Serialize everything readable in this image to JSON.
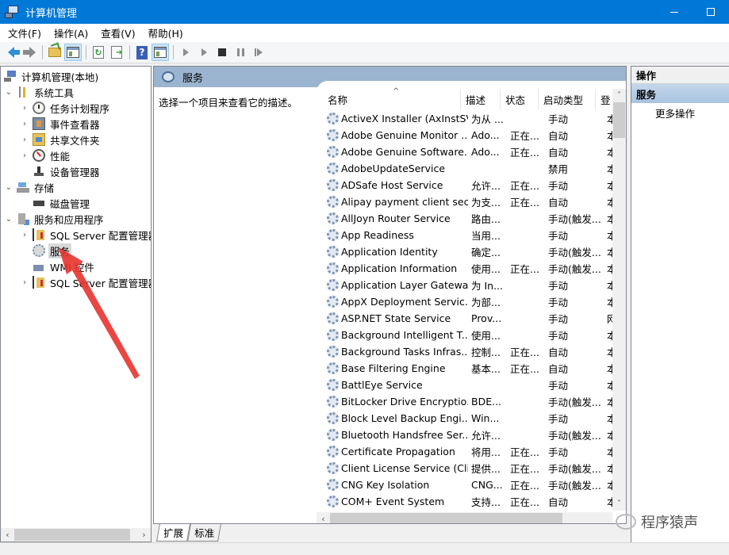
{
  "window": {
    "title": "计算机管理",
    "minimize_label": "—",
    "maximize_label": "□"
  },
  "menu": [
    "文件(F)",
    "操作(A)",
    "查看(V)",
    "帮助(H)"
  ],
  "toolbar": {
    "buttons": [
      "back-icon",
      "forward-icon",
      "up-folder-icon",
      "show-hide-tree-icon",
      "refresh-icon",
      "export-list-icon",
      "help-icon",
      "show-hide-action-pane-icon",
      "start-service-icon",
      "start-service-alt-icon",
      "stop-service-icon",
      "pause-service-icon",
      "resume-service-icon"
    ]
  },
  "tree": {
    "root": "计算机管理(本地)",
    "nodes": [
      {
        "label": "系统工具",
        "expander": "⌄"
      },
      {
        "label": "任务计划程序",
        "expander": "›"
      },
      {
        "label": "事件查看器",
        "expander": "›"
      },
      {
        "label": "共享文件夹",
        "expander": "›"
      },
      {
        "label": "性能",
        "expander": "›"
      },
      {
        "label": "设备管理器",
        "expander": ""
      },
      {
        "label": "存储",
        "expander": "⌄"
      },
      {
        "label": "磁盘管理",
        "expander": ""
      },
      {
        "label": "服务和应用程序",
        "expander": "⌄"
      },
      {
        "label": "SQL Server 配置管理器",
        "expander": "›"
      },
      {
        "label": "服务",
        "expander": "",
        "selected": true
      },
      {
        "label": "WMI 控件",
        "expander": ""
      },
      {
        "label": "SQL Server 配置管理器",
        "expander": "›"
      }
    ],
    "scroll_left": "‹",
    "scroll_right": "›"
  },
  "middle": {
    "header": "服务",
    "description": "选择一个项目来查看它的描述。",
    "columns": [
      "名称",
      "描述",
      "状态",
      "启动类型",
      "登"
    ],
    "sort_caret": "^",
    "rows": [
      {
        "name": "ActiveX Installer (AxInstSV)",
        "desc": "为从 ...",
        "status": "",
        "start": "手动",
        "logon": "本"
      },
      {
        "name": "Adobe Genuine Monitor ...",
        "desc": "Ado...",
        "status": "正在...",
        "start": "自动",
        "logon": "本"
      },
      {
        "name": "Adobe Genuine Software...",
        "desc": "Ado...",
        "status": "正在...",
        "start": "自动",
        "logon": "本"
      },
      {
        "name": "AdobeUpdateService",
        "desc": "",
        "status": "",
        "start": "禁用",
        "logon": "本"
      },
      {
        "name": "ADSafe Host Service",
        "desc": "允许...",
        "status": "正在...",
        "start": "手动",
        "logon": "本"
      },
      {
        "name": "Alipay payment client sec...",
        "desc": "为支...",
        "status": "正在...",
        "start": "自动",
        "logon": "本"
      },
      {
        "name": "AllJoyn Router Service",
        "desc": "路由...",
        "status": "",
        "start": "手动(触发...",
        "logon": "本"
      },
      {
        "name": "App Readiness",
        "desc": "当用...",
        "status": "",
        "start": "手动",
        "logon": "本"
      },
      {
        "name": "Application Identity",
        "desc": "确定...",
        "status": "",
        "start": "手动(触发...",
        "logon": "本"
      },
      {
        "name": "Application Information",
        "desc": "使用...",
        "status": "正在...",
        "start": "手动(触发...",
        "logon": "本"
      },
      {
        "name": "Application Layer Gatewa...",
        "desc": "为 In...",
        "status": "",
        "start": "手动",
        "logon": "本"
      },
      {
        "name": "AppX Deployment Servic...",
        "desc": "为部...",
        "status": "",
        "start": "手动",
        "logon": "本"
      },
      {
        "name": "ASP.NET State Service",
        "desc": "Prov...",
        "status": "",
        "start": "手动",
        "logon": "网"
      },
      {
        "name": "Background Intelligent T...",
        "desc": "使用...",
        "status": "",
        "start": "手动",
        "logon": "本"
      },
      {
        "name": "Background Tasks Infras...",
        "desc": "控制...",
        "status": "正在...",
        "start": "自动",
        "logon": "本"
      },
      {
        "name": "Base Filtering Engine",
        "desc": "基本...",
        "status": "正在...",
        "start": "自动",
        "logon": "本"
      },
      {
        "name": "BattlEye Service",
        "desc": "",
        "status": "",
        "start": "手动",
        "logon": "本"
      },
      {
        "name": "BitLocker Drive Encryptio...",
        "desc": "BDE...",
        "status": "",
        "start": "手动(触发...",
        "logon": "本"
      },
      {
        "name": "Block Level Backup Engi...",
        "desc": "Win...",
        "status": "",
        "start": "手动",
        "logon": "本"
      },
      {
        "name": "Bluetooth Handsfree Ser...",
        "desc": "允许...",
        "status": "",
        "start": "手动(触发...",
        "logon": "本"
      },
      {
        "name": "Certificate Propagation",
        "desc": "将用...",
        "status": "正在...",
        "start": "手动",
        "logon": "本"
      },
      {
        "name": "Client License Service (Cli...",
        "desc": "提供...",
        "status": "正在...",
        "start": "手动(触发...",
        "logon": "本"
      },
      {
        "name": "CNG Key Isolation",
        "desc": "CNG...",
        "status": "正在...",
        "start": "手动(触发...",
        "logon": "本"
      },
      {
        "name": "COM+ Event System",
        "desc": "支持...",
        "status": "正在...",
        "start": "自动",
        "logon": "本"
      }
    ],
    "scroll_up": "˄",
    "scroll_down": "˅",
    "scroll_left": "‹",
    "tabs": [
      "扩展",
      "标准"
    ]
  },
  "actions": {
    "header": "操作",
    "group": "服务",
    "items": [
      "更多操作"
    ]
  },
  "watermark": "程序猿声"
}
